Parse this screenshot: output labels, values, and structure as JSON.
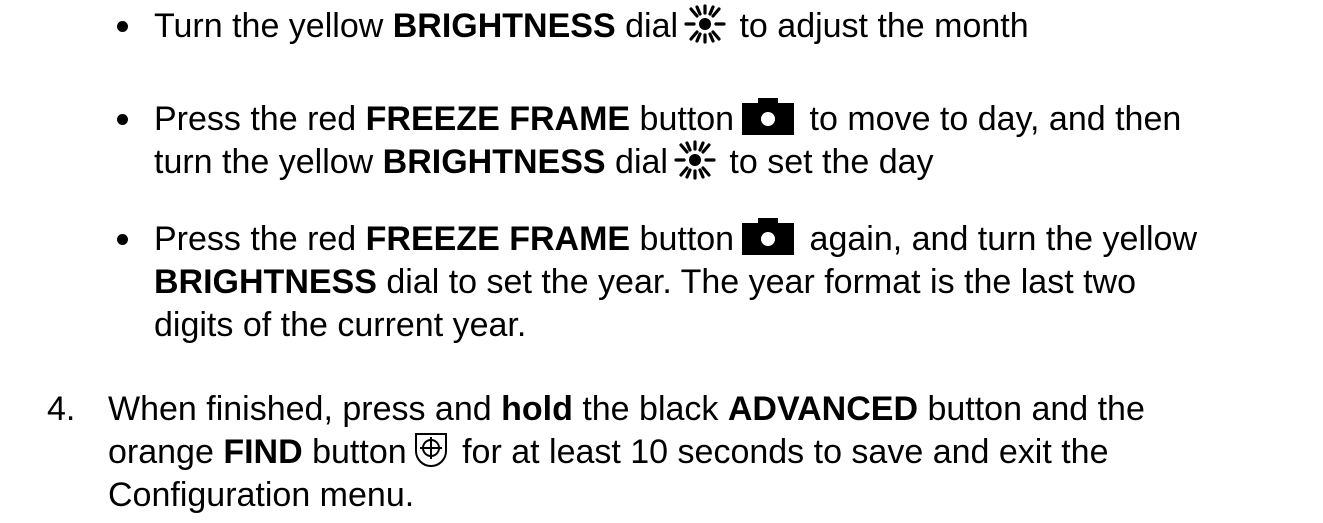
{
  "bullets": [
    {
      "lines": [
        [
          "Turn the yellow ",
          "BRIGHTNESS",
          " dial ",
          "[sun-icon]",
          " to adjust the month"
        ]
      ]
    },
    {
      "lines": [
        [
          "Press the red ",
          "FREEZE FRAME",
          " button ",
          "[camera-icon]",
          " to move to day, and then"
        ],
        [
          "turn the yellow ",
          "BRIGHTNESS",
          " dial ",
          "[sun-icon]",
          " to set the day"
        ]
      ]
    },
    {
      "lines": [
        [
          "Press the red ",
          "FREEZE FRAME",
          " button ",
          "[camera-icon]",
          " again, and turn the yellow"
        ],
        [
          "BRIGHTNESS",
          " dial to set the year. The year format is the last two"
        ],
        [
          "digits of the current year."
        ]
      ]
    }
  ],
  "step4": {
    "number": "4.",
    "line1_a": "When finished, press and ",
    "line1_b": "hold",
    "line1_c": " the black ",
    "line1_d": "ADVANCED",
    "line1_e": " button and the",
    "line2_a": "orange ",
    "line2_b": "FIND",
    "line2_c": " button",
    "line2_d": " for at least 10 seconds to save and exit the",
    "line3": "Configuration menu."
  },
  "b1": {
    "a": "Turn the yellow ",
    "b": "BRIGHTNESS",
    "c": " dial",
    "d": " to adjust the month"
  },
  "b2": {
    "l1a": "Press the red ",
    "l1b": "FREEZE FRAME",
    "l1c": " button",
    "l1d": " to move to day, and then",
    "l2a": "turn the yellow ",
    "l2b": "BRIGHTNESS",
    "l2c": " dial",
    "l2d": " to set the day"
  },
  "b3": {
    "l1a": "Press the red ",
    "l1b": "FREEZE FRAME",
    "l1c": " button",
    "l1d": " again, and turn the yellow",
    "l2a": "BRIGHTNESS",
    "l2b": " dial to set the year. The year format is the last two",
    "l3": "digits of the current year."
  },
  "icons": {
    "sun": "sun-icon",
    "camera": "camera-icon",
    "find": "find-icon"
  }
}
